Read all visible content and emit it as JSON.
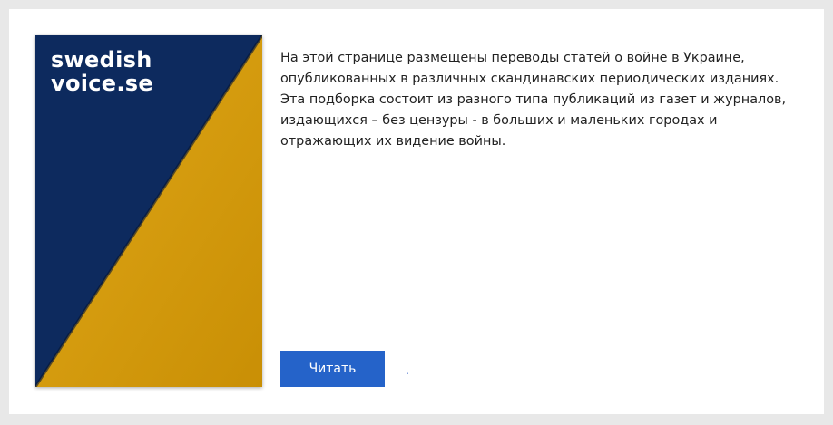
{
  "cover": {
    "logo_line1": "swedish",
    "logo_line2": "voice.se",
    "colors": {
      "navy": "#0d2a5e",
      "yellow": "#d39a0a"
    }
  },
  "description": "На этой странице размещены переводы статей о войне в Украине, опубликованных в различных скандинавских периодических изданиях. Эта подборка состоит из разного типа публикаций из газет и журналов, издающихся – без цензуры - в больших и маленьких городах и отражающих их видение войны.",
  "read_button": {
    "label": "Читать",
    "color": "#2563c9"
  },
  "dot_link": "."
}
